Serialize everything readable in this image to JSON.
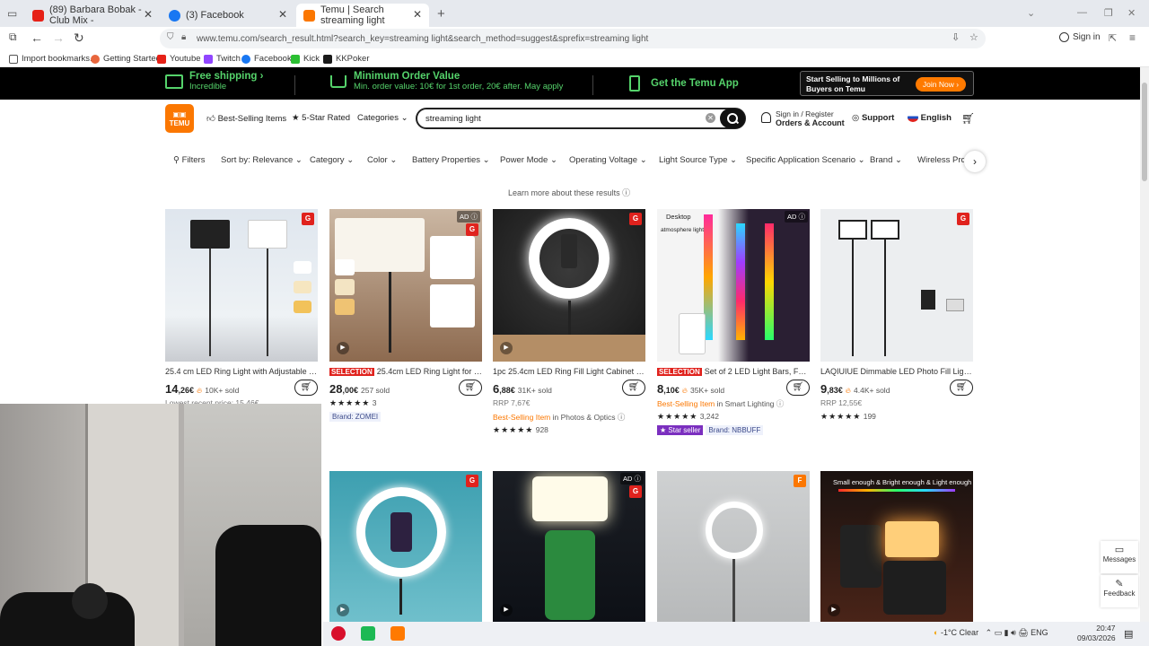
{
  "browser": {
    "tabs": [
      {
        "label": "(89) Barbara Bobak - Club Mix -",
        "favicon": "youtube-icon",
        "color": "#e62117"
      },
      {
        "label": "(3) Facebook",
        "favicon": "facebook-icon",
        "color": "#1877f2"
      },
      {
        "label": "Temu | Search streaming light",
        "favicon": "temu-icon",
        "color": "#fb7701"
      }
    ],
    "url": "www.temu.com/search_result.html?search_key=streaming light&search_method=suggest&sprefix=streaming light",
    "sign_in": "Sign in",
    "bookmarks": [
      "Import bookmarks...",
      "Getting Started",
      "Youtube",
      "Twitch",
      "Facebook",
      "Kick",
      "KKPoker"
    ]
  },
  "banner": {
    "free_shipping": "Free shipping",
    "incredible": "Incredible",
    "min_order_title": "Minimum Order Value",
    "min_order_sub": "Min. order value: 10€ for 1st order, 20€ after. May apply",
    "get_app": "Get the Temu App",
    "sell_line1": "Start Selling to Millions of",
    "sell_line2": "Buyers on Temu",
    "join_now": "Join Now"
  },
  "header": {
    "logo": "TEMU",
    "best_selling": "Best-Selling Items",
    "five_star": "5-Star Rated",
    "categories": "Categories",
    "search_value": "streaming light",
    "sign_in_register": "Sign in / Register",
    "orders_account": "Orders & Account",
    "support": "Support",
    "language": "English"
  },
  "filters": [
    "Filters",
    "Sort by: Relevance",
    "Category",
    "Color",
    "Battery Properties",
    "Power Mode",
    "Operating Voltage",
    "Light Source Type",
    "Specific Application Scenario",
    "Brand",
    "Wireless Prop"
  ],
  "learn_more": "Learn more about these results",
  "products": [
    {
      "title": "25.4 cm LED Ring Light with Adjustable Tri...",
      "selection": "",
      "price_int": "14",
      "price_dec": ",26€",
      "sold": "10K+ sold",
      "line3": "Lowest recent price: 15.46€",
      "line4": "",
      "line5": "",
      "stars": "",
      "rating_count": ""
    },
    {
      "title": "25.4cm LED Ring Light for Des...",
      "selection": "SELECTION",
      "price_int": "28",
      "price_dec": ",00€",
      "sold": "257 sold",
      "line3": "",
      "stars": "★★★★★",
      "rating_count": "3",
      "brand": "Brand: ZOMEI"
    },
    {
      "title": "1pc 25.4cm LED Ring Fill Light Cabinet Pho...",
      "selection": "",
      "price_int": "6",
      "price_dec": ",88€",
      "sold": "31K+ sold",
      "line3": "RRP 7,67€",
      "best": "Best-Selling Item",
      "best_cat": "in Photos & Optics",
      "stars": "★★★★★",
      "rating_count": "928"
    },
    {
      "title": "Set of 2 LED Light Bars, Featuri...",
      "selection": "SELECTION",
      "price_int": "8",
      "price_dec": ",10€",
      "sold": "35K+ sold",
      "best": "Best-Selling Item",
      "best_cat": "in Smart Lighting",
      "stars": "★★★★★",
      "rating_count": "3,242",
      "star_seller": "Star seller",
      "brand": "Brand: NBBUFF"
    },
    {
      "title": "LAQIUIUE Dimmable LED Photo Fill Light F...",
      "selection": "",
      "price_int": "9",
      "price_dec": ",83€",
      "sold": "4.4K+ sold",
      "line3": "RRP 12,55€",
      "stars": "★★★★★",
      "rating_count": "199"
    }
  ],
  "row2_overlay_text": "Small enough & Bright enough & Light enough",
  "desktop_label": "Desktop",
  "atmosphere_label": "atmosphere light",
  "side": {
    "messages": "Messages",
    "feedback": "Feedback"
  },
  "taskbar": {
    "weather": "-1°C  Clear",
    "lang": "ENG",
    "time": "20:47",
    "date": "09/03/2026"
  }
}
